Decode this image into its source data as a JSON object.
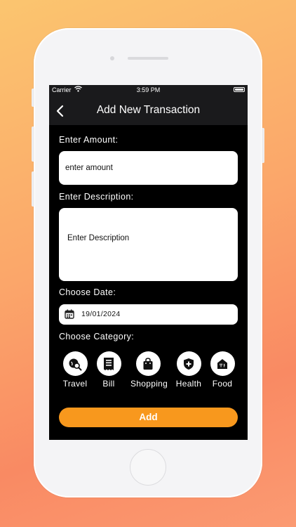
{
  "status_bar": {
    "carrier": "Carrier",
    "time": "3:59 PM"
  },
  "nav": {
    "title": "Add New Transaction",
    "back_icon": "chevron-left-icon"
  },
  "form": {
    "amount_label": "Enter Amount:",
    "amount_placeholder": "enter amount",
    "description_label": "Enter Description:",
    "description_placeholder": "Enter Description",
    "date_label": "Choose Date:",
    "date_value": "19/01/2024",
    "category_label": "Choose Category:"
  },
  "categories": [
    {
      "label": "Travel",
      "icon": "travel-search-icon"
    },
    {
      "label": "Bill",
      "icon": "bill-icon"
    },
    {
      "label": "Shopping",
      "icon": "shopping-bag-icon"
    },
    {
      "label": "Health",
      "icon": "health-shield-icon"
    },
    {
      "label": "Food",
      "icon": "food-icon"
    }
  ],
  "add_button": {
    "label": "Add"
  },
  "colors": {
    "accent": "#f8981d",
    "screen_bg": "#000000",
    "bar_bg": "#1a1a1c"
  }
}
